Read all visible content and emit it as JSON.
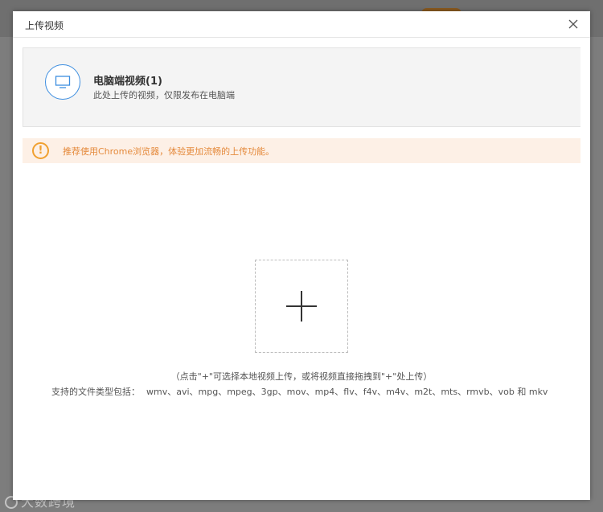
{
  "dialog": {
    "title": "上传视频",
    "close_icon": "close-icon"
  },
  "source": {
    "icon": "monitor-icon",
    "title": "电脑端视频(1)",
    "description": "此处上传的视频，仅限发布在电脑端"
  },
  "notice": {
    "icon": "warning-icon",
    "text": "推荐使用Chrome浏览器，体验更加流畅的上传功能。"
  },
  "upload": {
    "icon": "plus-icon",
    "hint": "（点击\"+\"可选择本地视频上传，或将视频直接拖拽到\"+\"处上传）",
    "formats_label": "支持的文件类型包括：",
    "formats": "wmv、avi、mpg、mpeg、3gp、mov、mp4、flv、f4v、m4v、m2t、mts、rmvb、vob 和 mkv"
  },
  "watermark": "大数跨境",
  "colors": {
    "accent": "#3d8ee0",
    "notice_bg": "#fdf0e6",
    "notice_text": "#e58a3c",
    "warning": "#f0a030"
  }
}
